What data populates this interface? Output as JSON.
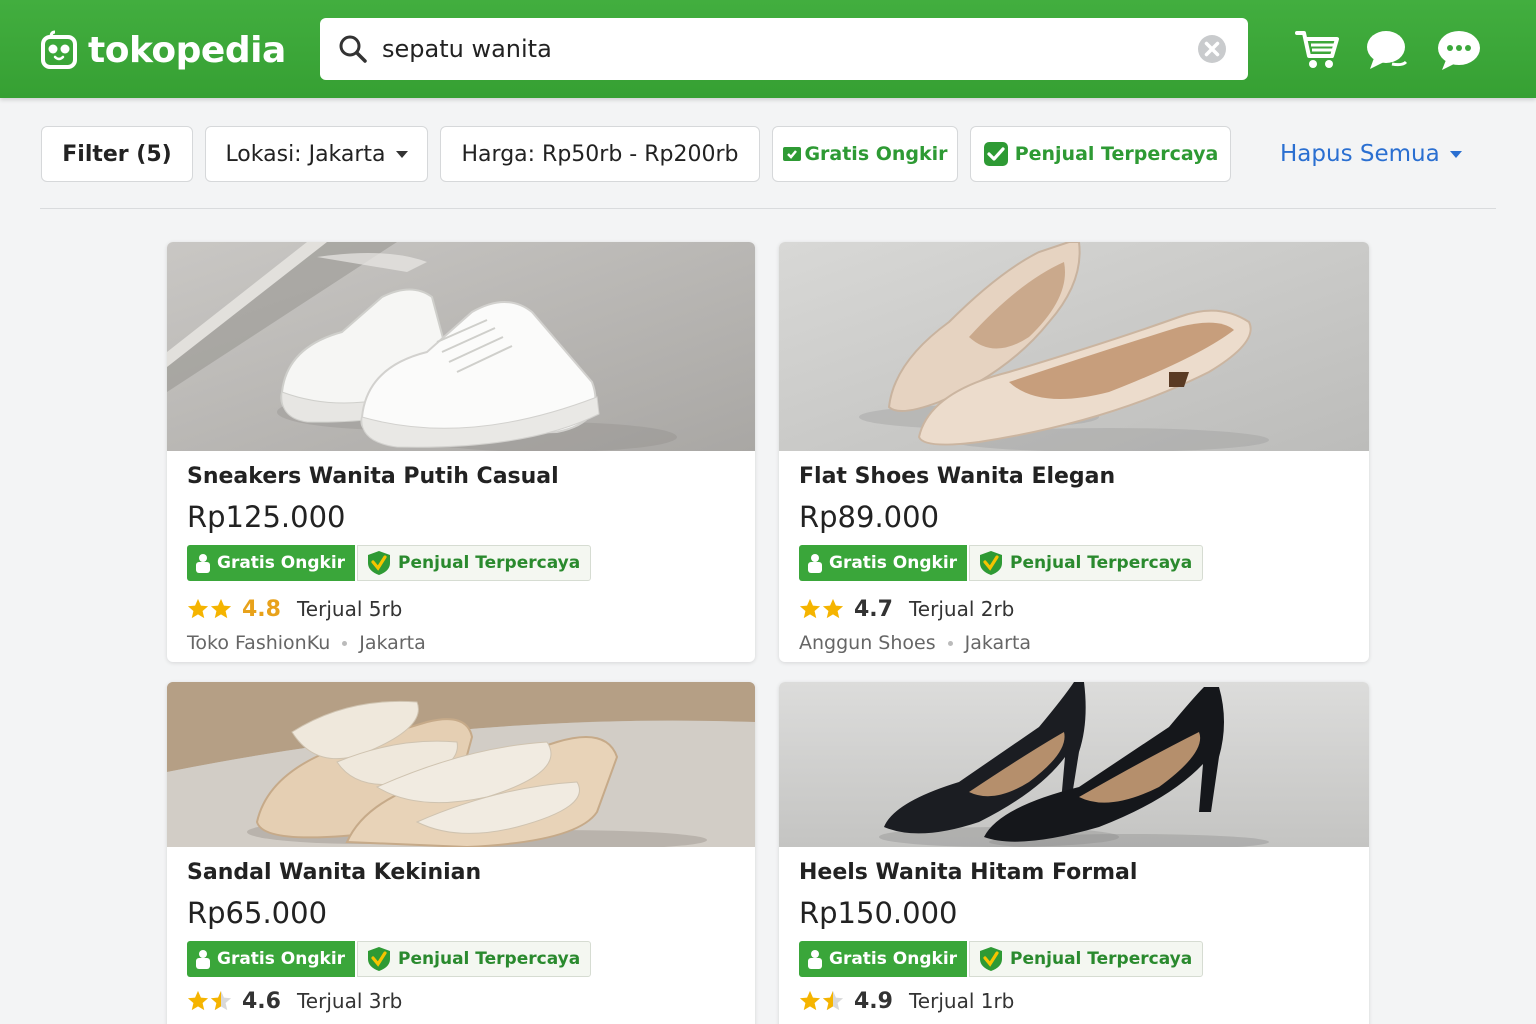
{
  "header": {
    "logo_text": "tokopedia",
    "search_value": "sepatu wanita"
  },
  "filters": {
    "filter_label": "Filter (5)",
    "lokasi_label": "Lokasi: Jakarta",
    "harga_label": "Harga: Rp50rb - Rp200rb",
    "gratis_label": "Gratis Ongkir",
    "terpercaya_label": "Penjual Terpercaya",
    "hapus_label": "Hapus Semua"
  },
  "products": [
    {
      "title": "Sneakers Wanita Putih Casual",
      "price": "Rp125.000",
      "badge_ongkir": "Gratis Ongkir",
      "badge_trust": "Penjual Terpercaya",
      "rating": "4.8",
      "sold": "Terjual 5rb",
      "shop": "Toko FashionKu",
      "location": "Jakarta",
      "rating_color": "#e8a21b"
    },
    {
      "title": "Flat Shoes Wanita Elegan",
      "price": "Rp89.000",
      "badge_ongkir": "Gratis Ongkir",
      "badge_trust": "Penjual Terpercaya",
      "rating": "4.7",
      "sold": "Terjual 2rb",
      "shop": "Anggun Shoes",
      "location": "Jakarta",
      "rating_color": "#333333"
    },
    {
      "title": "Sandal Wanita Kekinian",
      "price": "Rp65.000",
      "badge_ongkir": "Gratis Ongkir",
      "badge_trust": "Penjual Terpercaya",
      "rating": "4.6",
      "sold": "Terjual 3rb",
      "rating_color": "#333333"
    },
    {
      "title": "Heels Wanita Hitam Formal",
      "price": "Rp150.000",
      "badge_ongkir": "Gratis Ongkir",
      "badge_trust": "Penjual Terpercaya",
      "rating": "4.9",
      "sold": "Terjual 1rb",
      "rating_color": "#333333"
    }
  ],
  "colors": {
    "brand_green": "#3ba83b",
    "link_blue": "#2a6fd1",
    "star_gold": "#f5b400"
  },
  "icons": [
    "tokopedia-logo-icon",
    "search-icon",
    "clear-icon",
    "cart-icon",
    "chat-icon",
    "message-icon",
    "star-icon",
    "shield-check-icon",
    "bag-icon"
  ]
}
